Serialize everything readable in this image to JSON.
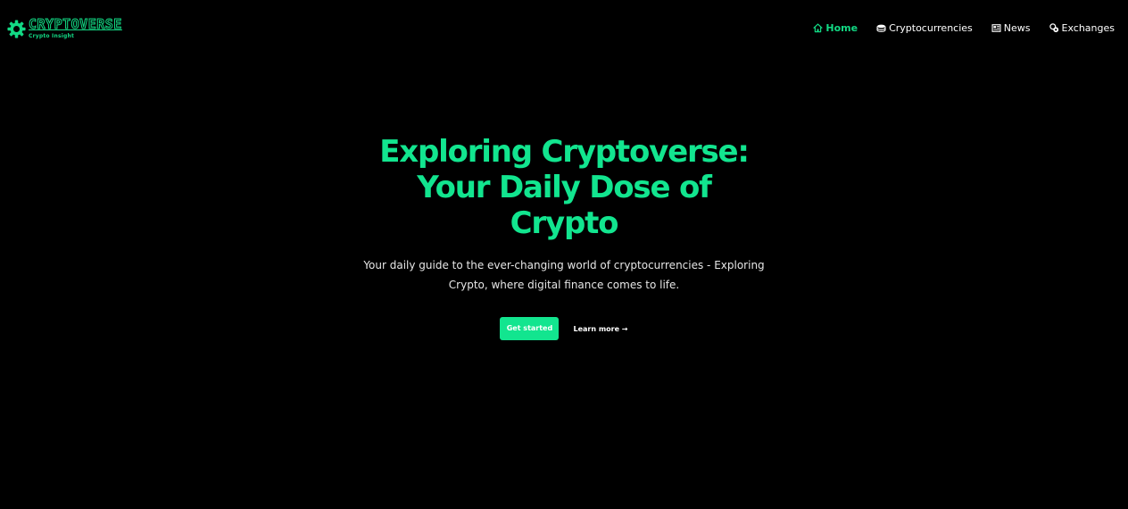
{
  "brand": {
    "name": "CRYPTOVERSE",
    "tagline": "Crypto Insight",
    "accent_color": "#12e58f"
  },
  "nav": {
    "items": [
      {
        "label": "Home",
        "icon": "home-icon",
        "active": true
      },
      {
        "label": "Cryptocurrencies",
        "icon": "coins-icon",
        "active": false
      },
      {
        "label": "News",
        "icon": "newspaper-icon",
        "active": false
      },
      {
        "label": "Exchanges",
        "icon": "exchange-icon",
        "active": false
      }
    ]
  },
  "hero": {
    "title": "Exploring Cryptoverse: Your Daily Dose of Crypto",
    "subtitle": "Your daily guide to the ever-changing world of cryptocurrencies - Exploring Crypto, where digital finance comes to life.",
    "primary_cta": "Get started",
    "secondary_cta": "Learn more →"
  }
}
